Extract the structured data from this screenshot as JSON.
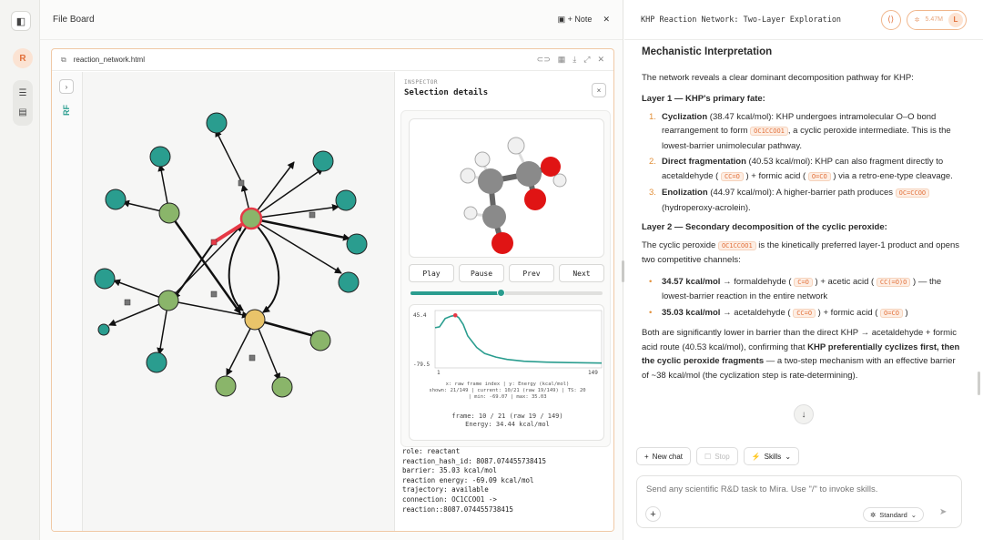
{
  "rail": {
    "avatar_letter": "R"
  },
  "board": {
    "title": "File Board",
    "note_label": "+ Note",
    "file_name": "reaction_network.html",
    "vp_label": "RF"
  },
  "graph": {
    "node_colors": {
      "teal": "#2a9d8f",
      "green": "#8ab56a",
      "yellow": "#e9c46a",
      "selected_ring": "#e63946"
    },
    "nodes": [
      {
        "id": "n1",
        "type": "teal"
      },
      {
        "id": "n2",
        "type": "teal"
      },
      {
        "id": "n3",
        "type": "teal"
      },
      {
        "id": "n4",
        "type": "teal"
      },
      {
        "id": "n5",
        "type": "teal"
      },
      {
        "id": "n6",
        "type": "teal"
      },
      {
        "id": "n7",
        "type": "teal"
      },
      {
        "id": "n8",
        "type": "teal"
      },
      {
        "id": "n9",
        "type": "teal"
      },
      {
        "id": "n10",
        "type": "teal"
      },
      {
        "id": "n11",
        "type": "green"
      },
      {
        "id": "n12",
        "type": "green"
      },
      {
        "id": "n13",
        "type": "green"
      },
      {
        "id": "n14",
        "type": "green"
      },
      {
        "id": "n15",
        "type": "green"
      },
      {
        "id": "khp",
        "type": "green-selected"
      },
      {
        "id": "n16",
        "type": "yellow"
      },
      {
        "id": "n17",
        "type": "teal"
      }
    ]
  },
  "inspector": {
    "subtitle": "INSPECTOR",
    "title": "Selection details",
    "close": "×",
    "buttons": {
      "play": "Play",
      "pause": "Pause",
      "prev": "Prev",
      "next": "Next"
    },
    "slider_fraction": 0.47,
    "plot": {
      "y_top": "45.4",
      "y_bottom": "-79.5",
      "x_left": "1",
      "x_right": "149",
      "caption1": "x: raw frame index | y: Energy (kcal/mol)",
      "caption2": "shown: 21/149 | current: 10/21 (raw 19/149) | TS: 20",
      "caption3": "| min: -69.07 | max: 35.03"
    },
    "frame_line": "frame: 10 / 21 (raw 19 / 149)",
    "energy_line": "Energy: 34.44 kcal/mol",
    "props": [
      "role: reactant",
      "reaction_hash_id: 8087.074455738415",
      "barrier: 35.03 kcal/mol",
      "reaction energy: -69.09 kcal/mol",
      "trajectory: available",
      "connection: OC1CCOO1 ->",
      "reaction::8087.074455738415"
    ]
  },
  "energy_curve": {
    "x": [
      1,
      5,
      10,
      15,
      19,
      22,
      26,
      30,
      38,
      45,
      55,
      65,
      80,
      100,
      120,
      149
    ],
    "y": [
      8,
      10,
      28,
      33,
      35,
      30,
      15,
      -10,
      -35,
      -48,
      -56,
      -61,
      -65,
      -67,
      -68,
      -69
    ],
    "xlim": [
      1,
      149
    ],
    "ylim": [
      -79.5,
      45.4
    ],
    "current_x": 19,
    "line_color": "#2a9d8f",
    "marker_color": "#e63946"
  },
  "right": {
    "title": "KHP Reaction Network: Two-Layer Exploration",
    "pill_text": "5.47M",
    "avatar": "L",
    "heading": "Mechanistic Interpretation",
    "intro": "The network reveals a clear dominant decomposition pathway for KHP:",
    "layer1": "Layer 1 — KHP's primary fate:",
    "l1": [
      {
        "num": "1.",
        "bold": "Cyclization",
        "a": " (38.47 kcal/mol): KHP undergoes intramolecular O–O bond rearrangement to form ",
        "code": "OC1CCOO1",
        "b": ", a cyclic peroxide intermediate. This is the lowest-barrier unimolecular pathway."
      },
      {
        "num": "2.",
        "bold": "Direct fragmentation",
        "a": " (40.53 kcal/mol): KHP can also fragment directly to acetaldehyde ( ",
        "code": "CC=O",
        "b": " ) + formic acid ( ",
        "code2": "O=CO",
        "c": " ) via a retro-ene-type cleavage."
      },
      {
        "num": "3.",
        "bold": "Enolization",
        "a": " (44.97 kcal/mol): A higher-barrier path produces ",
        "code": "OC=CCOO",
        "b": " (hydroperoxy-acrolein)."
      }
    ],
    "layer2": "Layer 2 — Secondary decomposition of the cyclic peroxide:",
    "l2_intro_a": "The cyclic peroxide ",
    "l2_intro_code": "OC1CCOO1",
    "l2_intro_b": " is the kinetically preferred layer-1 product and opens two competitive channels:",
    "l2": [
      {
        "bold": "34.57 kcal/mol",
        "a": " → formaldehyde ( ",
        "code": "C=O",
        "b": " ) + acetic acid ( ",
        "code2": "CC(=O)O",
        "c": " ) — the lowest-barrier reaction in the entire network"
      },
      {
        "bold": "35.03 kcal/mol",
        "a": " → acetaldehyde ( ",
        "code": "CC=O",
        "b": " ) + formic acid ( ",
        "code2": "O=CO",
        "c": " )"
      }
    ],
    "concl_a": "Both are significantly lower in barrier than the direct KHP → acetaldehyde + formic acid route (40.53 kcal/mol), confirming that ",
    "concl_bold": "KHP preferentially cyclizes first, then the cyclic peroxide fragments",
    "concl_b": " — a two-step mechanism with an effective barrier of ~38 kcal/mol (the cyclization step is rate-determining).",
    "toolbar": {
      "new_chat": "New chat",
      "stop": "Stop",
      "skills": "Skills"
    },
    "chat_placeholder": "Send any scientific R&D task to Mira. Use \"/\" to invoke skills.",
    "mode": "Standard"
  }
}
